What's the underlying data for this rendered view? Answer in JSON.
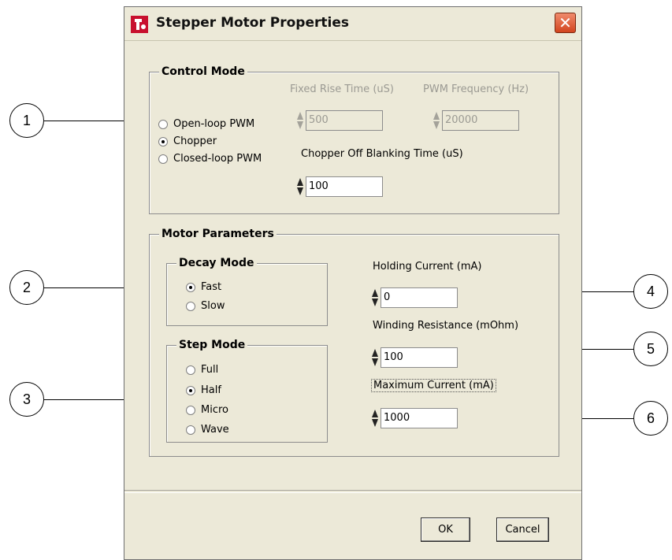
{
  "window": {
    "title": "Stepper Motor Properties",
    "close_symbol": "✕"
  },
  "control_mode": {
    "title": "Control Mode",
    "options": [
      {
        "label": "Open-loop PWM",
        "selected": false
      },
      {
        "label": "Chopper",
        "selected": true
      },
      {
        "label": "Closed-loop PWM",
        "selected": false
      }
    ],
    "fixed_rise_time": {
      "label": "Fixed Rise Time (uS)",
      "value": "500",
      "enabled": false
    },
    "pwm_frequency": {
      "label": "PWM Frequency (Hz)",
      "value": "20000",
      "enabled": false
    },
    "chopper_off_blanking": {
      "label": "Chopper Off Blanking Time (uS)",
      "value": "100"
    }
  },
  "motor_parameters": {
    "title": "Motor Parameters",
    "decay_mode": {
      "title": "Decay Mode",
      "options": [
        {
          "label": "Fast",
          "selected": true
        },
        {
          "label": "Slow",
          "selected": false
        }
      ]
    },
    "step_mode": {
      "title": "Step Mode",
      "options": [
        {
          "label": "Full",
          "selected": false
        },
        {
          "label": "Half",
          "selected": true
        },
        {
          "label": "Micro",
          "selected": false
        },
        {
          "label": "Wave",
          "selected": false
        }
      ]
    },
    "holding_current": {
      "label": "Holding Current (mA)",
      "value": "0"
    },
    "winding_resistance": {
      "label": "Winding Resistance (mOhm)",
      "value": "100"
    },
    "maximum_current": {
      "label": "Maximum Current (mA)",
      "value": "1000"
    }
  },
  "buttons": {
    "ok": "OK",
    "cancel": "Cancel"
  },
  "callouts": [
    "1",
    "2",
    "3",
    "4",
    "5",
    "6"
  ]
}
